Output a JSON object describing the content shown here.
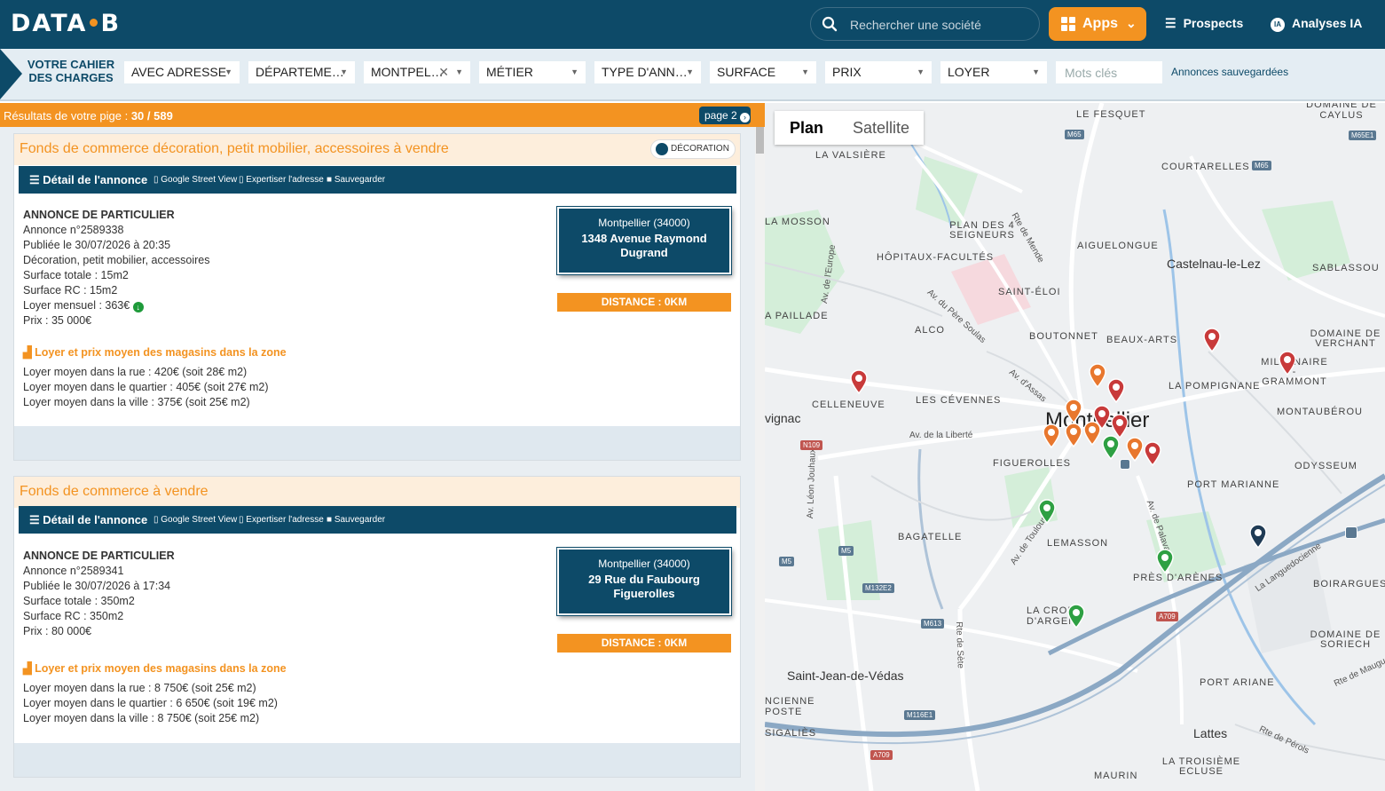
{
  "header": {
    "logo_left": "DATA",
    "logo_right": "B",
    "search_placeholder": "Rechercher une société",
    "apps_label": "Apps",
    "prospects_label": "Prospects",
    "ia_badge": "IA",
    "analyses_label": "Analyses IA"
  },
  "filters": {
    "cahier_line1": "VOTRE CAHIER",
    "cahier_line2": "DES CHARGES",
    "items": [
      {
        "label": "AVEC ADRESSE"
      },
      {
        "label": "DÉPARTEME…"
      },
      {
        "label": "MONTPEL…"
      },
      {
        "label": "MÉTIER"
      },
      {
        "label": "TYPE D'ANN…"
      },
      {
        "label": "SURFACE"
      },
      {
        "label": "PRIX"
      },
      {
        "label": "LOYER"
      }
    ],
    "keywords_placeholder": "Mots clés",
    "saved_label": "Annonces sauvegardées"
  },
  "results": {
    "label": "Résultats de votre pige : ",
    "count": "30 / 589",
    "page_label": "page 2"
  },
  "actions": {
    "detail": "Détail de l'annonce",
    "street_view": "Google Street View",
    "expertiser": "Expertiser l'adresse",
    "save": "Sauvegarder"
  },
  "listings": [
    {
      "title": "Fonds de commerce décoration, petit mobilier, accessoires à vendre",
      "tag": "DÉCORATION",
      "type": "ANNONCE DE PARTICULIER",
      "number": "Annonce n°2589338",
      "published": "Publiée le 30/07/2026 à 20:35",
      "activity": "Décoration, petit mobilier, accessoires",
      "surface_total": "Surface totale : 15m2",
      "surface_rc": "Surface RC : 15m2",
      "rent": "Loyer mensuel : 363€",
      "price": "Prix : 35 000€",
      "city": "Montpellier (34000)",
      "street": "1348 Avenue Raymond Dugrand",
      "distance": "DISTANCE : 0KM",
      "zone_title": "Loyer et prix moyen des magasins dans la zone",
      "zone_street": "Loyer moyen dans la rue : 420€ (soit 28€ m2)",
      "zone_quarter": "Loyer moyen dans le quartier : 405€ (soit 27€ m2)",
      "zone_city": "Loyer moyen dans la ville : 375€ (soit 25€ m2)"
    },
    {
      "title": "Fonds de commerce à vendre",
      "type": "ANNONCE DE PARTICULIER",
      "number": "Annonce n°2589341",
      "published": "Publiée le 30/07/2026 à 17:34",
      "surface_total": "Surface totale : 350m2",
      "surface_rc": "Surface RC : 350m2",
      "price": "Prix : 80 000€",
      "city": "Montpellier (34000)",
      "street": "29 Rue du Faubourg Figuerolles",
      "distance": "DISTANCE : 0KM",
      "zone_title": "Loyer et prix moyen des magasins dans la zone",
      "zone_street": "Loyer moyen dans la rue : 8 750€ (soit 25€ m2)",
      "zone_quarter": "Loyer moyen dans le quartier : 6 650€ (soit 19€ m2)",
      "zone_city": "Loyer moyen dans la ville : 8 750€ (soit 25€ m2)"
    }
  ],
  "map": {
    "plan_label": "Plan",
    "satellite_label": "Satellite",
    "labels": {
      "fesquet": "LE FESQUET",
      "caylus": "DOMAINE DE CAYLUS",
      "valsiere": "LA VALSIÈRE",
      "courtarelles": "COURTARELLES",
      "mosson": "LA MOSSON",
      "plan_des_4": "PLAN DES 4 SEIGNEURS",
      "aiguelongue": "AIGUELONGUE",
      "hopitaux": "HÔPITAUX-FACULTÉS",
      "castelnau": "Castelnau-le-Lez",
      "sablassou": "SABLASSOU",
      "saint_eloi": "SAINT-ÉLOI",
      "paillade": "A PAILLADE",
      "alco": "ALCO",
      "boutonnet": "BOUTONNET",
      "beaux_arts": "BEAUX-ARTS",
      "verchant": "DOMAINE DE VERCHANT",
      "millenaire": "MILLÉNAIRE - GRAMMONT",
      "pompignane": "LA POMPIGNANE",
      "celleneuve": "CELLENEUVE",
      "cevennes": "LES CÉVENNES",
      "montpellier": "Montpellier",
      "montauberou": "MONTAUBÉROU",
      "juvignac": "vignac",
      "figuerolles": "FIGUEROLLES",
      "odysseum": "ODYSSEUM",
      "port_marianne": "PORT MARIANNE",
      "bagatelle": "BAGATELLE",
      "lemasson": "LEMASSON",
      "pres_arenes": "PRÈS D'ARÈNES",
      "boirargues": "BOIRARGUES",
      "croix_argent": "LA CROIX D'ARGENT",
      "soriech": "DOMAINE DE SORIECH",
      "saint_jean": "Saint-Jean-de-Védas",
      "port_ariane": "PORT ARIANE",
      "poste": "NCIENNE POSTE",
      "sigalies": "SIGALIÈS",
      "lattes": "Lattes",
      "troisieme": "LA TROISIÈME ECLUSE",
      "maurin": "MAURIN",
      "mende": "Rte de Mende",
      "europe": "Av. de l'Europe",
      "pere_soulas": "Av. du Père Soulas",
      "assas": "Av. d'Assas",
      "liberte": "Av. de la Liberté",
      "jouhaux": "Av. Léon Jouhaux",
      "toulouse": "Av. de Toulouse",
      "palavas": "Av. de Palavas",
      "sete": "Rte de Sète",
      "languedocienne": "La Languedocienne",
      "perols": "Rte de Pérols",
      "mauguio": "Rte de Maugu"
    },
    "shields": [
      "M65",
      "M65",
      "M65E1",
      "N109",
      "M5",
      "M5",
      "M132E2",
      "M613",
      "M116E1",
      "A709",
      "A709"
    ]
  },
  "colors": {
    "navy": "#0d4a68",
    "orange": "#f39321",
    "marker_red": "#c83a3a",
    "marker_orange": "#e8772e",
    "marker_green": "#2ea043"
  }
}
